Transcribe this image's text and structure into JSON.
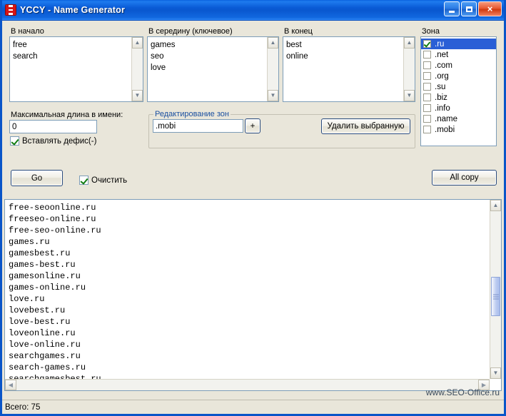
{
  "window": {
    "title": "YCCY  - Name Generator",
    "icon": "app-shield-icon",
    "minimize_label": "",
    "maximize_label": "",
    "close_label": "×"
  },
  "groups": {
    "prefix": {
      "label": "В начало",
      "lines": "free\nsearch"
    },
    "middle": {
      "label": "В середину (ключевое)",
      "lines": "games\nseo\nlove"
    },
    "suffix": {
      "label": "В конец",
      "lines": "best\nonline"
    },
    "zone": {
      "label": "Зона",
      "items": [
        {
          "label": ".ru",
          "checked": true,
          "selected": true
        },
        {
          "label": ".net",
          "checked": false,
          "selected": false
        },
        {
          "label": ".com",
          "checked": false,
          "selected": false
        },
        {
          "label": ".org",
          "checked": false,
          "selected": false
        },
        {
          "label": ".su",
          "checked": false,
          "selected": false
        },
        {
          "label": ".biz",
          "checked": false,
          "selected": false
        },
        {
          "label": ".info",
          "checked": false,
          "selected": false
        },
        {
          "label": ".name",
          "checked": false,
          "selected": false
        },
        {
          "label": ".mobi",
          "checked": false,
          "selected": false
        }
      ]
    }
  },
  "options": {
    "max_length_label": "Максимальная длина в имени:",
    "max_length_value": "0",
    "hyphen_label": "Вставлять дефис(-)",
    "hyphen_checked": true
  },
  "zone_editor": {
    "label": "Редактирование зон",
    "input_value": ".mobi",
    "add_label": "+",
    "delete_label": "Удалить выбранную"
  },
  "actions": {
    "go_label": "Go",
    "clear_label": "Очистить",
    "clear_checked": true,
    "all_copy_label": "All copy"
  },
  "results": {
    "lines": "free-seoonline.ru\nfreeseo-online.ru\nfree-seo-online.ru\ngames.ru\ngamesbest.ru\ngames-best.ru\ngamesonline.ru\ngames-online.ru\nlove.ru\nlovebest.ru\nlove-best.ru\nloveonline.ru\nlove-online.ru\nsearchgames.ru\nsearch-games.ru\nsearchgamesbest.ru",
    "scroll_up_icon": "▲",
    "scroll_down_icon": "▼",
    "scroll_left_icon": "◀",
    "scroll_right_icon": "▶"
  },
  "statusbar": {
    "total_label": "Всего: 75",
    "watermark": "www.SEO-Office.ru"
  },
  "colors": {
    "title_blue": "#0A55C8",
    "window_bg": "#E9E6DA",
    "selection_blue": "#2A5FD6",
    "check_green": "#107C10",
    "close_red": "#CF3A10"
  }
}
